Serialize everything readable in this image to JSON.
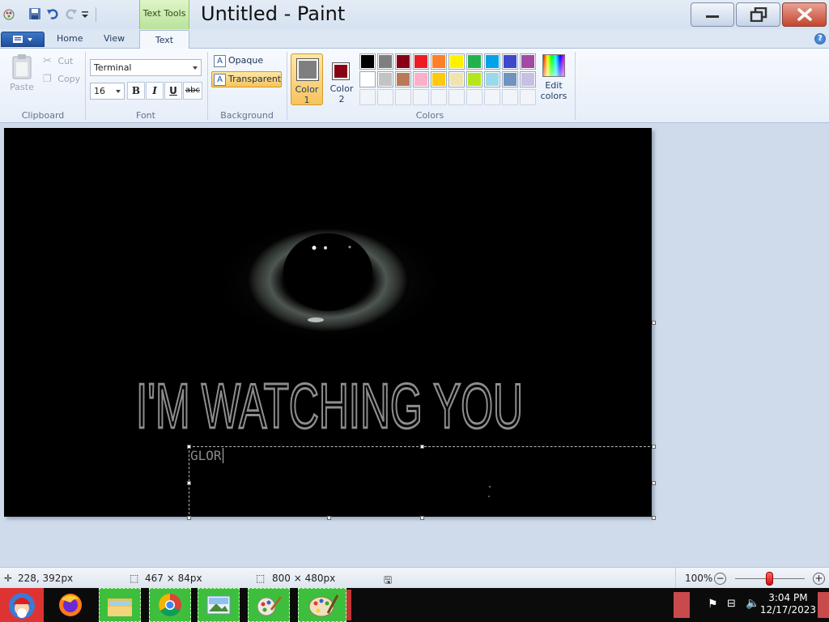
{
  "window": {
    "title": "Untitled - Paint",
    "context_tab": "Text Tools"
  },
  "tabs": {
    "home": "Home",
    "view": "View",
    "text": "Text"
  },
  "clipboard": {
    "paste": "Paste",
    "cut": "Cut",
    "copy": "Copy",
    "label": "Clipboard"
  },
  "font": {
    "family": "Terminal",
    "size": "16",
    "bold": "B",
    "italic": "I",
    "underline": "U",
    "strike": "abc",
    "label": "Font"
  },
  "background": {
    "opaque": "Opaque",
    "transparent": "Transparent",
    "label": "Background"
  },
  "colors": {
    "color1_label": "Color",
    "color1_num": "1",
    "color2_label": "Color",
    "color2_num": "2",
    "color1": "#7f7f7f",
    "color2": "#880015",
    "edit_label": "Edit",
    "edit_label2": "colors",
    "label": "Colors",
    "palette_row1": [
      "#000000",
      "#7f7f7f",
      "#880015",
      "#ed1c24",
      "#ff7f27",
      "#fff200",
      "#22b14c",
      "#00a2e8",
      "#3f48cc",
      "#a349a4"
    ],
    "palette_row2": [
      "#ffffff",
      "#c3c3c3",
      "#b97a57",
      "#ffaec9",
      "#ffc90e",
      "#efe4b0",
      "#b5e61d",
      "#99d9ea",
      "#7092be",
      "#c8bfe7"
    ]
  },
  "canvas": {
    "headline": "I'M WATCHING YOU",
    "typed_text": "GLOR"
  },
  "status": {
    "cursor_pos": "228, 392px",
    "selection_size": "467 × 84px",
    "canvas_size": "800 × 480px",
    "zoom": "100%"
  },
  "taskbar": {
    "time": "3:04 PM",
    "date": "12/17/2023"
  }
}
